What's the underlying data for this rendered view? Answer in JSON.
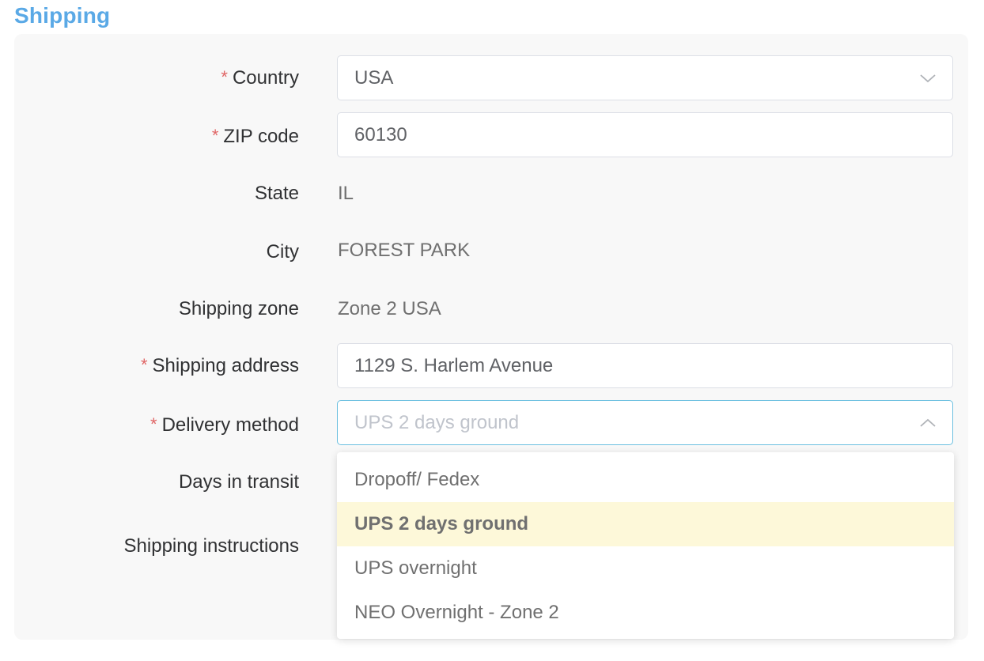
{
  "section": {
    "title": "Shipping"
  },
  "required_mark": "*",
  "form": {
    "country": {
      "label": "Country",
      "value": "USA"
    },
    "zip": {
      "label": "ZIP code",
      "value": "60130"
    },
    "state": {
      "label": "State",
      "value": "IL"
    },
    "city": {
      "label": "City",
      "value": "FOREST PARK"
    },
    "zone": {
      "label": "Shipping zone",
      "value": "Zone 2 USA"
    },
    "address": {
      "label": "Shipping address",
      "value": "1129 S. Harlem Avenue"
    },
    "delivery": {
      "label": "Delivery method",
      "placeholder": "UPS 2 days ground"
    },
    "transit": {
      "label": "Days in transit"
    },
    "instructions": {
      "label": "Shipping instructions"
    }
  },
  "delivery_options": [
    {
      "label": "Dropoff/ Fedex",
      "selected": false
    },
    {
      "label": "UPS 2 days ground",
      "selected": true
    },
    {
      "label": "UPS overnight",
      "selected": false
    },
    {
      "label": "NEO Overnight - Zone 2",
      "selected": false
    }
  ],
  "colors": {
    "title": "#5aa9e6",
    "required": "#e06666",
    "focus_border": "#6cc0e0",
    "selected_option_bg": "#fdf8d9"
  },
  "icons": {
    "country_select": "chevron-down-icon",
    "delivery_select": "chevron-up-icon"
  }
}
